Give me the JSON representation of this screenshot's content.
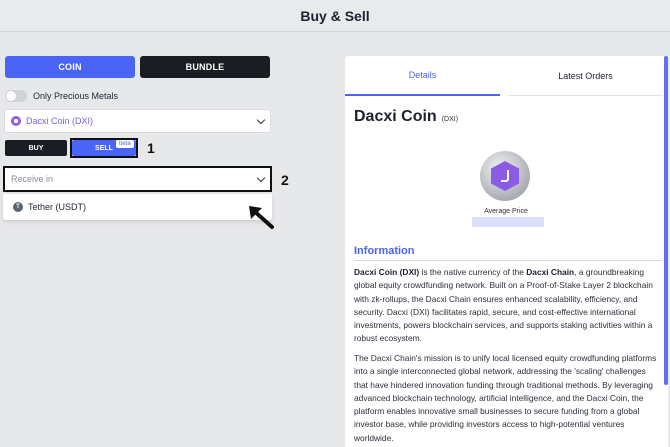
{
  "header": {
    "title": "Buy & Sell"
  },
  "left": {
    "coin_tab": "COIN",
    "bundle_tab": "BUNDLE",
    "toggle_label": "Only Precious Metals",
    "coin_select": {
      "value": "Dacxi Coin (DXI)",
      "icon": "dxi-coin-icon"
    },
    "buy_label": "BUY",
    "sell_label": "SELL",
    "sell_badge": "beta",
    "receive": {
      "placeholder": "Receive in",
      "options": [
        "Tether (USDT)"
      ]
    },
    "annotations": [
      "1",
      "2"
    ]
  },
  "panel": {
    "tabs": [
      "Details",
      "Latest Orders"
    ],
    "coin_name": "Dacxi Coin",
    "coin_symbol": "(DXI)",
    "avg_price_label": "Average Price",
    "info_heading": "Information",
    "para1": {
      "b1": "Dacxi Coin (DXI)",
      "t1": " is the native currency of the ",
      "b2": "Dacxi Chain",
      "t2": ", a groundbreaking global equity crowdfunding network. Built on a Proof-of-Stake Layer 2 blockchain with zk-rollups, the Dacxi Chain ensures enhanced scalability, efficiency, and security. Dacxi (DXI) facilitates rapid, secure, and cost-effective international investments, powers blockchain services, and supports staking activities within a robust ecosystem."
    },
    "para2": "The Dacxi Chain's mission is to unify local licensed equity crowdfunding platforms into a single interconnected global network, addressing the 'scaling' challenges that have hindered innovation funding through traditional methods. By leveraging advanced blockchain technology, artificial intelligence, and the Dacxi Coin, the platform enables innovative small businesses to secure funding from a global investor base, while providing investors access to high-potential ventures worldwide."
  },
  "colors": {
    "accent": "#4a64f6",
    "dark": "#1b1d24",
    "coin_purple": "#8b5be4"
  }
}
